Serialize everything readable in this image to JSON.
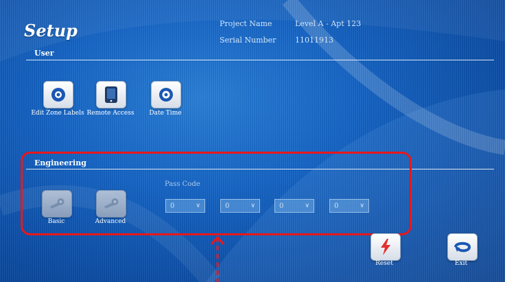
{
  "title": "Setup",
  "project": {
    "name_label": "Project Name",
    "name_value": "Level A - Apt 123",
    "serial_label": "Serial Number",
    "serial_value": "11011913"
  },
  "user_section": {
    "label": "User",
    "items": [
      {
        "label": "Edit Zone Labels",
        "icon": "eye-icon"
      },
      {
        "label": "Remote Access",
        "icon": "tablet-icon"
      },
      {
        "label": "Date Time",
        "icon": "clock-icon"
      }
    ]
  },
  "engineering_section": {
    "label": "Engineering",
    "basic_label": "Basic",
    "advanced_label": "Advanced",
    "pass_code_label": "Pass Code",
    "pass_digits": [
      "0",
      "0",
      "0",
      "0"
    ]
  },
  "actions": {
    "reset_label": "Reset",
    "exit_label": "Exit"
  },
  "colors": {
    "highlight": "#e8171b",
    "background": "#1565c6"
  }
}
